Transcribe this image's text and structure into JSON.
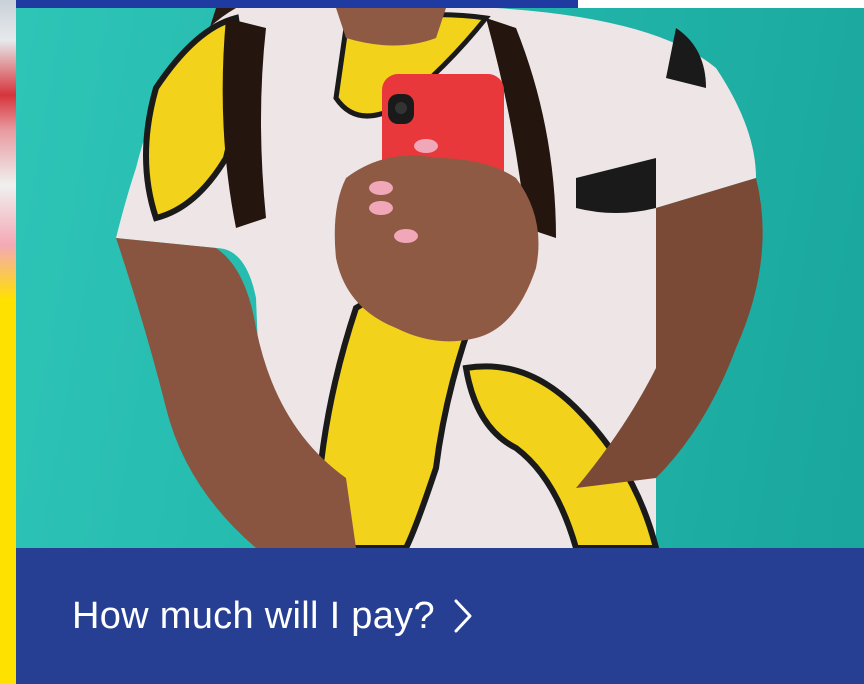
{
  "hero": {
    "image": "woman-holding-red-smartphone-banana-tshirt",
    "background_color": "#23b8ad"
  },
  "cta": {
    "label": "How much will I pay?",
    "icon": "chevron-right-icon",
    "background_color": "#263f92"
  }
}
